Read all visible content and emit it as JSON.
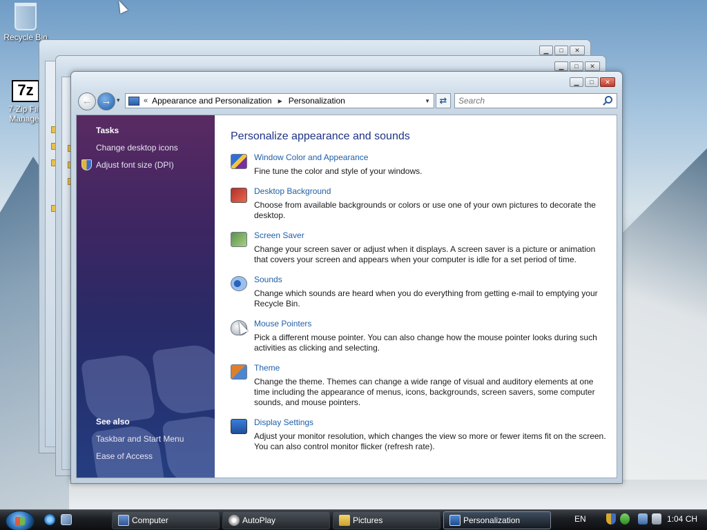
{
  "desktop": {
    "icons": [
      {
        "label": "Recycle Bin",
        "icon": "recycle-bin-icon"
      },
      {
        "label": "7-Zip File Manager",
        "icon": "7zip-icon",
        "glyph": "7z"
      }
    ]
  },
  "window": {
    "controls": {
      "minimize": "▁",
      "maximize": "□",
      "close": "✕"
    },
    "nav": {
      "back": "←",
      "forward": "→",
      "dropdown": "▾"
    },
    "address": {
      "chevron": "«",
      "parts": [
        "Appearance and Personalization",
        "Personalization"
      ],
      "separator": "▶",
      "dropdown": "▼"
    },
    "refresh": "⇄",
    "search": {
      "placeholder": "Search"
    }
  },
  "sidebar": {
    "tasks_heading": "Tasks",
    "tasks": [
      "Change desktop icons",
      "Adjust font size (DPI)"
    ],
    "see_also_heading": "See also",
    "see_also": [
      "Taskbar and Start Menu",
      "Ease of Access"
    ]
  },
  "main": {
    "title": "Personalize appearance and sounds",
    "items": [
      {
        "title": "Window Color and Appearance",
        "desc": "Fine tune the color and style of your windows.",
        "icon": "window-color-icon"
      },
      {
        "title": "Desktop Background",
        "desc": "Choose from available backgrounds or colors or use one of your own pictures to decorate the desktop.",
        "icon": "desktop-background-icon"
      },
      {
        "title": "Screen Saver",
        "desc": "Change your screen saver or adjust when it displays. A screen saver is a picture or animation that covers your screen and appears when your computer is idle for a set period of time.",
        "icon": "screen-saver-icon"
      },
      {
        "title": "Sounds",
        "desc": "Change which sounds are heard when you do everything from getting e-mail to emptying your Recycle Bin.",
        "icon": "sounds-icon"
      },
      {
        "title": "Mouse Pointers",
        "desc": "Pick a different mouse pointer. You can also change how the mouse pointer looks during such activities as clicking and selecting.",
        "icon": "mouse-pointers-icon"
      },
      {
        "title": "Theme",
        "desc": "Change the theme. Themes can change a wide range of visual and auditory elements at one time including the appearance of menus, icons, backgrounds, screen savers, some computer sounds, and mouse pointers.",
        "icon": "theme-icon"
      },
      {
        "title": "Display Settings",
        "desc": "Adjust your monitor resolution, which changes the view so more or fewer items fit on the screen. You can also control monitor flicker (refresh rate).",
        "icon": "display-settings-icon"
      }
    ]
  },
  "taskbar": {
    "buttons": [
      {
        "label": "Computer",
        "active": false
      },
      {
        "label": "AutoPlay",
        "active": false
      },
      {
        "label": "Pictures",
        "active": false
      },
      {
        "label": "Personalization",
        "active": true
      }
    ],
    "language": "EN",
    "clock": "1:04 CH"
  }
}
